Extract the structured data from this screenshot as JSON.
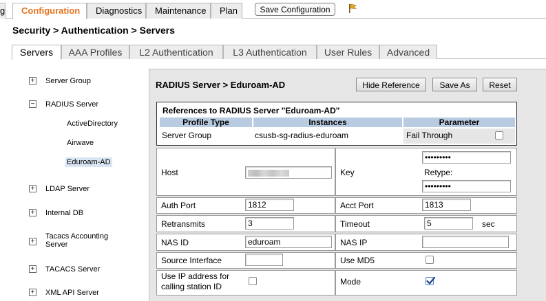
{
  "top_tabs": [
    {
      "label": "g"
    },
    {
      "label": "Configuration"
    },
    {
      "label": "Diagnostics"
    },
    {
      "label": "Maintenance"
    },
    {
      "label": "Plan"
    }
  ],
  "toolbar": {
    "save_config_label": "Save Configuration",
    "flag_icon": "flag-icon"
  },
  "page": {
    "title": "Security > Authentication > Servers"
  },
  "sub_tabs": [
    {
      "label": "Servers"
    },
    {
      "label": "AAA Profiles"
    },
    {
      "label": "L2 Authentication"
    },
    {
      "label": "L3 Authentication"
    },
    {
      "label": "User Rules"
    },
    {
      "label": "Advanced"
    }
  ],
  "tree": {
    "server_group": "Server Group",
    "radius_server": "RADIUS Server",
    "active_directory": "ActiveDirectory",
    "airwave": "Airwave",
    "eduroam": "Eduroam-AD",
    "ldap_server": "LDAP Server",
    "internal_db": "Internal DB",
    "tacacs_accounting_1": "Tacacs Accounting",
    "tacacs_accounting_2": "Server",
    "tacacs_server": "TACACS Server",
    "xml_api_server": "XML API Server",
    "expand_plus": "+",
    "expand_minus": "−"
  },
  "panel": {
    "title": "RADIUS Server > Eduroam-AD",
    "hide_reference": "Hide Reference",
    "save_as": "Save As",
    "reset": "Reset"
  },
  "references": {
    "title": "References to RADIUS Server \"Eduroam-AD\"",
    "headers": [
      "Profile Type",
      "Instances",
      "Parameter"
    ],
    "row": {
      "profile_type": "Server Group",
      "instances": "csusb-sg-radius-eduroam",
      "parameter": "Fail Through",
      "checked": false
    }
  },
  "form": {
    "host_label": "Host",
    "host_value": "",
    "key_label": "Key",
    "key_value": "•••••••••",
    "retype_label": "Retype:",
    "retype_value": "•••••••••",
    "auth_port_label": "Auth Port",
    "auth_port_value": "1812",
    "acct_port_label": "Acct Port",
    "acct_port_value": "1813",
    "retransmits_label": "Retransmits",
    "retransmits_value": "3",
    "timeout_label": "Timeout",
    "timeout_value": "5",
    "timeout_unit": "sec",
    "nas_id_label": "NAS ID",
    "nas_id_value": "eduroam",
    "nas_ip_label": "NAS IP",
    "nas_ip_value": "",
    "source_interface_label": "Source Interface",
    "source_interface_value": "",
    "use_md5_label": "Use MD5",
    "use_md5_checked": false,
    "use_ip_label_1": "Use IP address for",
    "use_ip_label_2": "calling station ID",
    "use_ip_checked": false,
    "mode_label": "Mode",
    "mode_checked": true
  },
  "colors": {
    "active_tab_text": "#e5731f",
    "ref_header_bg": "#b9cbe0",
    "panel_bg": "#e6e6e6",
    "selected_tree_bg": "#dbe6f5"
  }
}
